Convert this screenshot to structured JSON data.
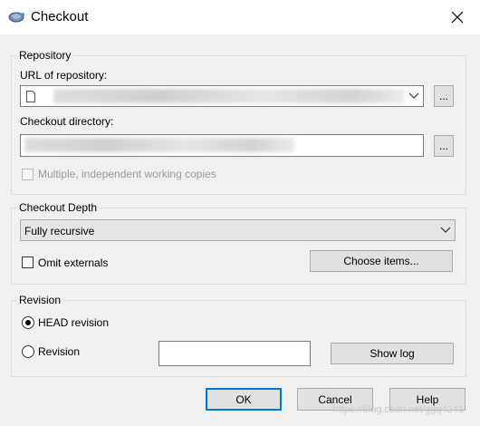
{
  "window": {
    "title": "Checkout",
    "close_icon": "close-icon",
    "app_icon": "tortoise-icon"
  },
  "repository": {
    "group_label": "Repository",
    "url_label": "URL of repository:",
    "url_value": "",
    "browse_label": "...",
    "dir_label": "Checkout directory:",
    "dir_value": "",
    "dir_browse_label": "...",
    "multiple_label": "Multiple, independent working copies",
    "multiple_checked": false
  },
  "depth": {
    "group_label": "Checkout Depth",
    "selected": "Fully recursive",
    "omit_label": "Omit externals",
    "omit_checked": false,
    "choose_label": "Choose items..."
  },
  "revision": {
    "group_label": "Revision",
    "head_label": "HEAD revision",
    "head_selected": true,
    "rev_label": "Revision",
    "rev_value": "",
    "showlog_label": "Show log"
  },
  "buttons": {
    "ok": "OK",
    "cancel": "Cancel",
    "help": "Help"
  },
  "watermark": "https://blog.csdn.net/ggq4241"
}
